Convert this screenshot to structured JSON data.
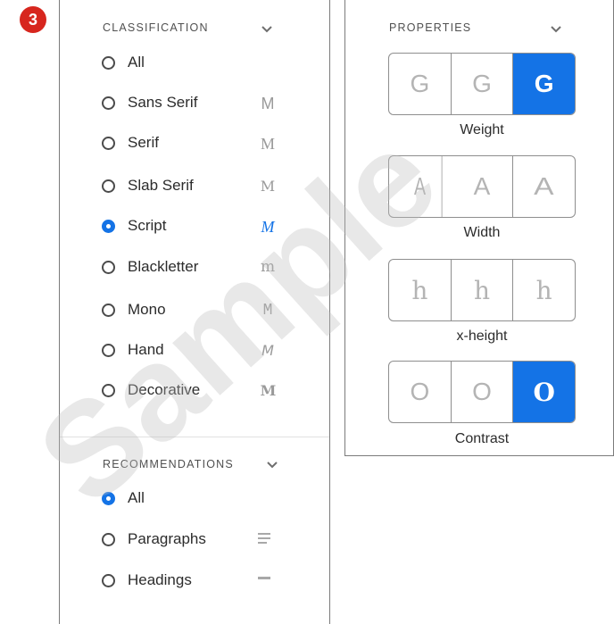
{
  "step_badge": "3",
  "classification": {
    "title": "CLASSIFICATION",
    "items": [
      {
        "label": "All",
        "selected": false,
        "sample": ""
      },
      {
        "label": "Sans Serif",
        "selected": false,
        "sample": "M"
      },
      {
        "label": "Serif",
        "selected": false,
        "sample": "M"
      },
      {
        "label": "Slab Serif",
        "selected": false,
        "sample": "M"
      },
      {
        "label": "Script",
        "selected": true,
        "sample": "M"
      },
      {
        "label": "Blackletter",
        "selected": false,
        "sample": "m"
      },
      {
        "label": "Mono",
        "selected": false,
        "sample": "M"
      },
      {
        "label": "Hand",
        "selected": false,
        "sample": "M"
      },
      {
        "label": "Decorative",
        "selected": false,
        "sample": "M"
      }
    ]
  },
  "recommendations": {
    "title": "RECOMMENDATIONS",
    "items": [
      {
        "label": "All",
        "selected": true
      },
      {
        "label": "Paragraphs",
        "selected": false
      },
      {
        "label": "Headings",
        "selected": false
      }
    ]
  },
  "properties": {
    "title": "PROPERTIES",
    "groups": [
      {
        "caption": "Weight",
        "glyphs": [
          "G",
          "G",
          "G"
        ],
        "selected": 2
      },
      {
        "caption": "Width",
        "glyphs": [
          "A",
          "A",
          "A"
        ],
        "selected": -1
      },
      {
        "caption": "x-height",
        "glyphs": [
          "h",
          "h",
          "h"
        ],
        "selected": -1
      },
      {
        "caption": "Contrast",
        "glyphs": [
          "O",
          "O",
          "O"
        ],
        "selected": 2
      }
    ]
  },
  "watermark": "Sample",
  "colors": {
    "accent": "#1473e6",
    "badge": "#d7261e"
  }
}
